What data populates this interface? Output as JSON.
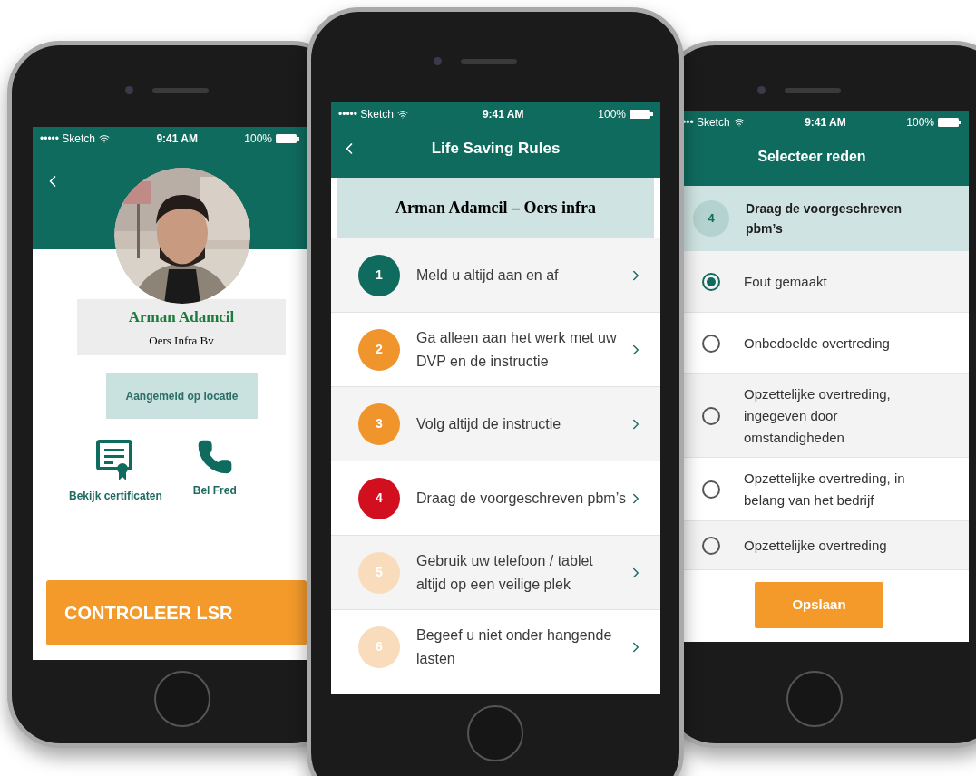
{
  "profile_screen": {
    "status_bar": {
      "carrier": "••••• Sketch",
      "time": "9:41 AM",
      "battery": "100%"
    },
    "name": "Arman Adamcil",
    "company": "Oers Infra Bv",
    "status_badge": "Aangemeld op locatie",
    "actions": [
      {
        "kind": "certificate",
        "label": "Bekijk certificaten"
      },
      {
        "kind": "phone",
        "label": "Bel Fred"
      }
    ],
    "primary_button": "CONTROLEER LSR"
  },
  "rules_screen": {
    "status_bar": {
      "carrier": "••••• Sketch",
      "time": "9:41 AM",
      "battery": "100%"
    },
    "title": "Life Saving Rules",
    "banner": "Arman Adamcil – Oers infra",
    "rules": [
      {
        "number": "1",
        "text": "Meld u altijd aan en af",
        "color": "#0f6b5e"
      },
      {
        "number": "2",
        "text": "Ga alleen aan het werk met uw DVP en de instructie",
        "color": "#f0942c"
      },
      {
        "number": "3",
        "text": "Volg altijd de instructie",
        "color": "#f0942c"
      },
      {
        "number": "4",
        "text": "Draag de voorgeschreven pbm’s",
        "color": "#d20f1e"
      },
      {
        "number": "5",
        "text": "Gebruik uw telefoon / tablet altijd op een veilige plek",
        "color": "#f9dcbc"
      },
      {
        "number": "6",
        "text": "Begeef u niet onder hangende lasten",
        "color": "#f9dcbc"
      }
    ]
  },
  "reason_screen": {
    "status_bar": {
      "carrier": "••• Sketch",
      "time": "9:41 AM",
      "battery": "100%"
    },
    "title": "Selecteer reden",
    "rule_number": "4",
    "rule_text": "Draag de voorgeschreven pbm’s",
    "options": [
      {
        "text": "Fout gemaakt",
        "selected": true
      },
      {
        "text": "Onbedoelde overtreding",
        "selected": false
      },
      {
        "text": "Opzettelijke overtreding, ingegeven door omstandigheden",
        "selected": false
      },
      {
        "text": "Opzettelijke overtreding, in belang van het bedrijf",
        "selected": false
      },
      {
        "text": "Opzettelijke overtreding",
        "selected": false
      }
    ],
    "save_button": "Opslaan"
  }
}
